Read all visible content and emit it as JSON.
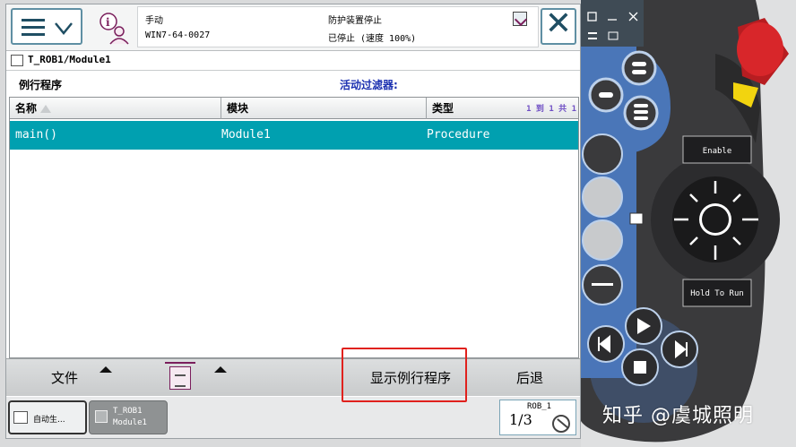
{
  "status": {
    "mode": "手动",
    "controller": "WIN7-64-0027",
    "state": "防护装置停止",
    "speed_state": "已停止 (速度 100%)"
  },
  "breadcrumb": "T_ROB1/Module1",
  "section": {
    "title": "例行程序",
    "filter_label": "活动过滤器:"
  },
  "table": {
    "headers": [
      "名称",
      "模块",
      "类型"
    ],
    "pager": "1 到 1 共 1",
    "rows": [
      {
        "name": "main()",
        "module": "Module1",
        "type": "Procedure"
      }
    ]
  },
  "bottombar": {
    "file": "文件",
    "show_routine": "显示例行程序",
    "back": "后退"
  },
  "taskbar": {
    "auto": "自动生...",
    "module_line1": "T_ROB1",
    "module_line2": "Module1",
    "quickset_label": "ROB_1",
    "quickset_fraction": "1/3"
  },
  "pendant": {
    "enable_label": "Enable",
    "hold_label": "Hold To Run"
  },
  "watermark": "知乎 @虞城照明",
  "colors": {
    "selected_row": "#00a0b0",
    "filter_text": "#1a2fb0",
    "highlight_box": "#e0211d",
    "pendant_body": "#3a3a3c",
    "pendant_blue": "#4a76b8",
    "emergency_red": "#d8262a",
    "enable_yellow": "#f2d40f"
  }
}
